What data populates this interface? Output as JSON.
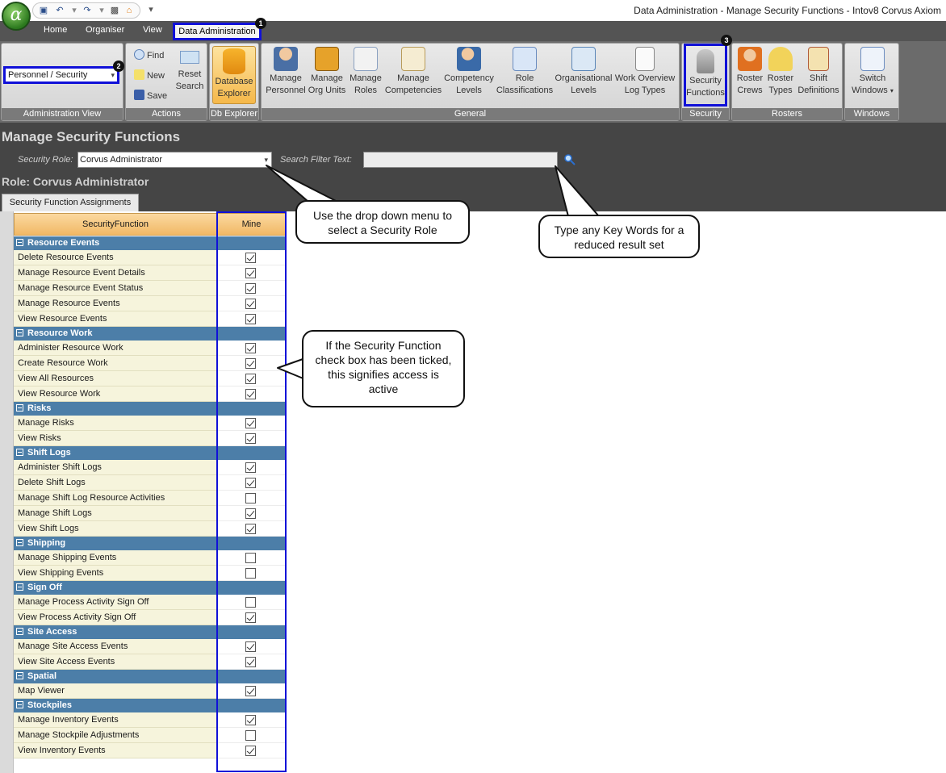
{
  "window_title": "Data Administration - Manage Security Functions - Intov8 Corvus Axiom",
  "tabs": [
    "Home",
    "Organiser",
    "View",
    "Data Administration"
  ],
  "markers": [
    "1",
    "2",
    "3"
  ],
  "admin_view": {
    "selected": "Personnel / Security",
    "label": "Administration View"
  },
  "actions": {
    "find": "Find",
    "new": "New",
    "save": "Save",
    "reset_line1": "Reset",
    "reset_line2": "Search",
    "label": "Actions"
  },
  "db_explorer": {
    "line1": "Database",
    "line2": "Explorer",
    "label": "Db Explorer"
  },
  "general": {
    "label": "General",
    "buttons": [
      {
        "l1": "Manage",
        "l2": "Personnel"
      },
      {
        "l1": "Manage",
        "l2": "Org Units"
      },
      {
        "l1": "Manage",
        "l2": "Roles"
      },
      {
        "l1": "Manage",
        "l2": "Competencies"
      },
      {
        "l1": "Competency",
        "l2": "Levels"
      },
      {
        "l1": "Role",
        "l2": "Classifications"
      },
      {
        "l1": "Organisational",
        "l2": "Levels"
      },
      {
        "l1": "Work Overview",
        "l2": "Log Types"
      }
    ]
  },
  "security": {
    "l1": "Security",
    "l2": "Functions",
    "label": "Security"
  },
  "rosters": {
    "label": "Rosters",
    "buttons": [
      {
        "l1": "Roster",
        "l2": "Crews"
      },
      {
        "l1": "Roster",
        "l2": "Types"
      },
      {
        "l1": "Shift",
        "l2": "Definitions"
      }
    ]
  },
  "windows": {
    "l1": "Switch",
    "l2": "Windows",
    "label": "Windows"
  },
  "page_title": "Manage Security Functions",
  "security_role_label": "Security Role:",
  "security_role_value": "Corvus Administrator",
  "search_filter_label": "Search Filter Text:",
  "search_filter_value": "",
  "role_heading": "Role:  Corvus Administrator",
  "sub_tab": "Security Function Assignments",
  "columns": {
    "function": "SecurityFunction",
    "mine": "Mine"
  },
  "groups": [
    {
      "name": "Resource Events",
      "rows": [
        {
          "name": "Delete Resource Events",
          "checked": true
        },
        {
          "name": "Manage Resource Event Details",
          "checked": true
        },
        {
          "name": "Manage Resource Event Status",
          "checked": true
        },
        {
          "name": "Manage Resource Events",
          "checked": true
        },
        {
          "name": "View Resource Events",
          "checked": true
        }
      ]
    },
    {
      "name": "Resource Work",
      "rows": [
        {
          "name": "Administer Resource Work",
          "checked": true
        },
        {
          "name": "Create Resource Work",
          "checked": true
        },
        {
          "name": "View All Resources",
          "checked": true
        },
        {
          "name": "View Resource Work",
          "checked": true
        }
      ]
    },
    {
      "name": "Risks",
      "rows": [
        {
          "name": "Manage Risks",
          "checked": true
        },
        {
          "name": "View Risks",
          "checked": true
        }
      ]
    },
    {
      "name": "Shift Logs",
      "rows": [
        {
          "name": "Administer Shift Logs",
          "checked": true
        },
        {
          "name": "Delete Shift Logs",
          "checked": true
        },
        {
          "name": "Manage Shift Log Resource Activities",
          "checked": false
        },
        {
          "name": "Manage Shift Logs",
          "checked": true
        },
        {
          "name": "View Shift Logs",
          "checked": true
        }
      ]
    },
    {
      "name": "Shipping",
      "rows": [
        {
          "name": "Manage Shipping Events",
          "checked": false
        },
        {
          "name": "View Shipping Events",
          "checked": false
        }
      ]
    },
    {
      "name": "Sign Off",
      "rows": [
        {
          "name": "Manage Process Activity Sign Off",
          "checked": false
        },
        {
          "name": "View Process Activity Sign Off",
          "checked": true
        }
      ]
    },
    {
      "name": "Site Access",
      "rows": [
        {
          "name": "Manage Site Access Events",
          "checked": true
        },
        {
          "name": "View Site Access Events",
          "checked": true
        }
      ]
    },
    {
      "name": "Spatial",
      "rows": [
        {
          "name": "Map Viewer",
          "checked": true
        }
      ]
    },
    {
      "name": "Stockpiles",
      "rows": [
        {
          "name": "Manage Inventory Events",
          "checked": true
        },
        {
          "name": "Manage Stockpile Adjustments",
          "checked": false
        },
        {
          "name": "View Inventory Events",
          "checked": true
        }
      ]
    }
  ],
  "callouts": {
    "dropdown": "Use the drop down menu to select a Security Role",
    "keywords": "Type any Key Words for a reduced result set",
    "checkbox": "If the Security Function check box has been ticked, this signifies access is active"
  }
}
